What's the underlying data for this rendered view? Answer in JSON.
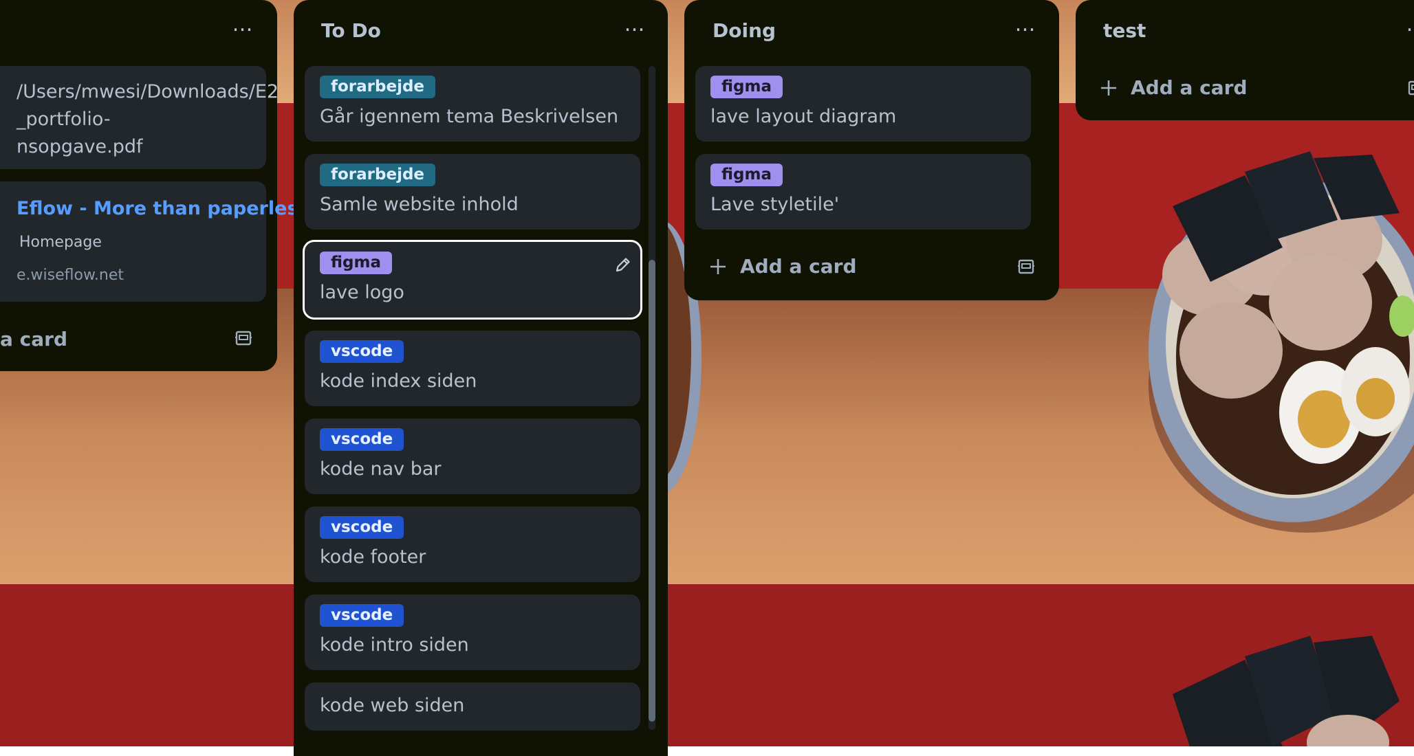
{
  "left_list": {
    "card1_lines": [
      "/Users/mwesi/Downloads/E2",
      "_portfolio-",
      "nsopgave.pdf"
    ],
    "card2_link": "Eflow - More than paperless",
    "card2_sub": "Homepage",
    "card2_url": "e.wiseflow.net",
    "add_card": "a card"
  },
  "todo_list": {
    "title": "To Do",
    "cards": [
      {
        "label": "forarbejde",
        "title": "Går igennem tema Beskrivelsen"
      },
      {
        "label": "forarbejde",
        "title": "Samle website inhold"
      },
      {
        "label": "figma",
        "title": "lave logo"
      },
      {
        "label": "vscode",
        "title": "kode index siden"
      },
      {
        "label": "vscode",
        "title": "kode nav bar"
      },
      {
        "label": "vscode",
        "title": "kode footer"
      },
      {
        "label": "vscode",
        "title": "kode intro siden"
      },
      {
        "title": "kode web siden"
      }
    ]
  },
  "doing_list": {
    "title": "Doing",
    "cards": [
      {
        "label": "figma",
        "title": "lave layout diagram"
      },
      {
        "label": "figma",
        "title": "Lave styletile'"
      }
    ],
    "add_card": "Add a card"
  },
  "test_list": {
    "title": "test",
    "add_card": "Add a card"
  },
  "colors": {
    "list_bg": "#101204",
    "card_bg": "#22272b",
    "label_forarbejde": "#206a83",
    "label_figma": "#9f8fef",
    "label_vscode": "#1f53d1",
    "link": "#579dff",
    "board_red": "#a82020",
    "board_tan": "#d79a68"
  },
  "icons": [
    "more-icon",
    "plus-icon",
    "template-icon",
    "edit-pencil-icon"
  ]
}
